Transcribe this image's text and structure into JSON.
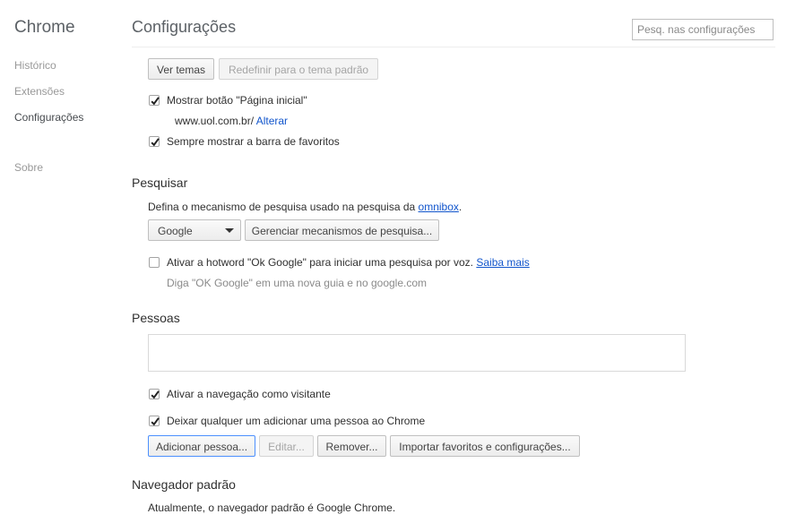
{
  "sidebar": {
    "brand": "Chrome",
    "items": [
      {
        "label": "Histórico"
      },
      {
        "label": "Extensões"
      },
      {
        "label": "Configurações"
      },
      {
        "label": "Sobre"
      }
    ]
  },
  "header": {
    "title": "Configurações",
    "search_placeholder": "Pesq. nas configurações"
  },
  "appearance": {
    "view_themes_button": "Ver temas",
    "reset_theme_button": "Redefinir para o tema padrão",
    "show_home_button_label": "Mostrar botão \"Página inicial\"",
    "show_home_button_checked": true,
    "home_url": "www.uol.com.br/",
    "change_link": "Alterar",
    "show_bookmarks_bar_label": "Sempre mostrar a barra de favoritos",
    "show_bookmarks_bar_checked": true
  },
  "search": {
    "title": "Pesquisar",
    "description_prefix": "Defina o mecanismo de pesquisa usado na pesquisa da ",
    "omnibox_link": "omnibox",
    "description_suffix": ".",
    "engine_selected": "Google",
    "manage_engines_button": "Gerenciar mecanismos de pesquisa...",
    "hotword_label": "Ativar a hotword \"Ok Google\" para iniciar uma pesquisa por voz.",
    "hotword_checked": false,
    "learn_more_link": "Saiba mais",
    "hotword_hint": "Diga \"OK Google\" em uma nova guia e no google.com"
  },
  "people": {
    "title": "Pessoas",
    "guest_browsing_label": "Ativar a navegação como visitante",
    "guest_browsing_checked": true,
    "anyone_add_label": "Deixar qualquer um adicionar uma pessoa ao Chrome",
    "anyone_add_checked": true,
    "add_person_button": "Adicionar pessoa...",
    "edit_button": "Editar...",
    "remove_button": "Remover...",
    "import_button": "Importar favoritos e configurações..."
  },
  "default_browser": {
    "title": "Navegador padrão",
    "status": "Atualmente, o navegador padrão é Google Chrome."
  },
  "icons": {
    "checkmark": "checkmark-icon",
    "dropdown_arrow": "dropdown-arrow-icon"
  },
  "colors": {
    "link": "#1155cc",
    "focus_border": "#4d90fe"
  }
}
